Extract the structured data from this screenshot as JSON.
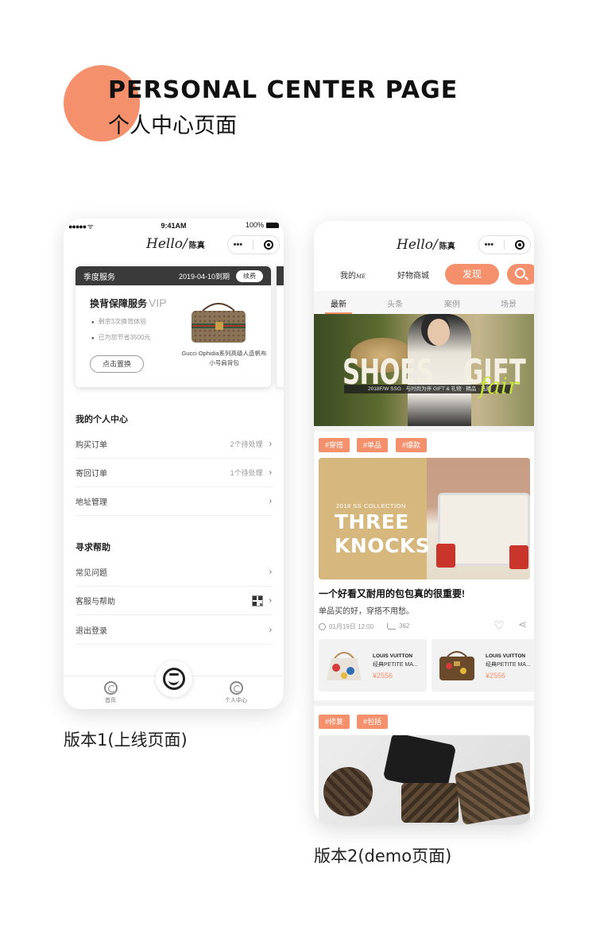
{
  "header": {
    "title_en": "PERSONAL CENTER PAGE",
    "title_cn": "个人中心页面",
    "accent_color": "#f4906b"
  },
  "version1": {
    "caption": "版本1(上线页面)",
    "status": {
      "time": "9:41AM",
      "battery": "100%"
    },
    "nav": {
      "hello": "Hello/",
      "name": "陈真",
      "menu": "•••"
    },
    "service_card": {
      "label": "季度服务",
      "expiry": "2019-04-10到期",
      "renew": "续费",
      "title": "换背保障服务",
      "vip": "VIP",
      "line1": "剩余3次换背体验",
      "line2": "已为您节省3500元",
      "button": "点击置换",
      "product_name": "Gucci Ophidia系列高级人造帆布小号肩背包"
    },
    "my_center": {
      "title": "我的个人中心",
      "rows": [
        {
          "label": "购买订单",
          "status": "2个待处理"
        },
        {
          "label": "寄回订单",
          "status": "1个待处理"
        },
        {
          "label": "地址管理",
          "status": ""
        }
      ]
    },
    "help": {
      "title": "寻求帮助",
      "rows": [
        {
          "label": "常见问题"
        },
        {
          "label": "客服与帮助"
        },
        {
          "label": "退出登录"
        }
      ]
    },
    "tabbar": {
      "home": "首页",
      "profile": "个人中心"
    }
  },
  "version2": {
    "caption": "版本2(demo页面)",
    "nav": {
      "hello": "Hello/",
      "name": "陈真",
      "menu": "•••"
    },
    "top_nav": {
      "mine": "我的",
      "mine_suffix": "ME",
      "shop": "好物商城",
      "discover": "发现"
    },
    "subtabs": [
      "最新",
      "头条",
      "案例",
      "场景"
    ],
    "banner": {
      "word1": "SHOES",
      "word2": "GIFT",
      "script": "fair",
      "strip": "2018F/W SSG · 与时尚为伴 GIFT & 礼物 · 精品 · 选购"
    },
    "tags1": [
      "#穿搭",
      "#单品",
      "#爆款"
    ],
    "article": {
      "collection": "2018 SS COLLECTION",
      "headline1": "THREE",
      "headline2": "KNOCKS",
      "title": "一个好看又耐用的包包真的很重要!",
      "subtitle": "单品买的好，穿搭不用愁。",
      "date": "01月19日 12:00",
      "views": "362"
    },
    "products": [
      {
        "brand": "LOUIS VUITTON",
        "name": "经典PETITE MA...",
        "price": "¥2556"
      },
      {
        "brand": "LOUIS VUITTON",
        "name": "经典PETITE MA...",
        "price": "¥2556"
      }
    ],
    "tags2": [
      "#修复",
      "#包括"
    ]
  }
}
